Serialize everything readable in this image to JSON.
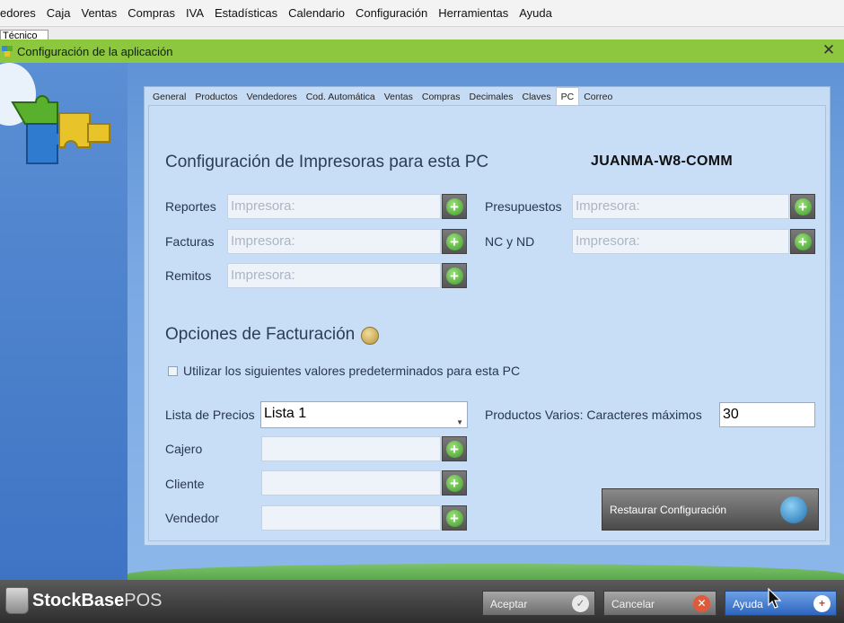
{
  "menubar": {
    "items": [
      "edores",
      "Caja",
      "Ventas",
      "Compras",
      "IVA",
      "Estadísticas",
      "Calendario",
      "Configuración",
      "Herramientas",
      "Ayuda"
    ]
  },
  "subtab": {
    "label": "Técnico"
  },
  "dialog": {
    "title": "Configuración de la aplicación",
    "close": "✕"
  },
  "tabs": [
    "General",
    "Productos",
    "Vendedores",
    "Cod. Automática",
    "Ventas",
    "Compras",
    "Decimales",
    "Claves",
    "PC",
    "Correo"
  ],
  "printers": {
    "title": "Configuración de Impresoras para esta PC",
    "pc_name": "JUANMA-W8-COMM",
    "placeholder": "Impresora:",
    "reportes_label": "Reportes",
    "facturas_label": "Facturas",
    "remitos_label": "Remitos",
    "presupuestos_label": "Presupuestos",
    "ncnd_label": "NC y ND"
  },
  "billing": {
    "title": "Opciones de Facturación",
    "checkbox_label": "Utilizar los siguientes valores predeterminados para esta PC",
    "lista_label": "Lista de Precios",
    "lista_value": "Lista 1",
    "cajero_label": "Cajero",
    "cliente_label": "Cliente",
    "vendedor_label": "Vendedor",
    "varios_label": "Productos Varios: Caracteres máximos",
    "varios_value": "30"
  },
  "restore_label": "Restaurar Configuración",
  "add_glyph": "+",
  "footer": {
    "logo_main": "StockBase",
    "logo_suffix": "POS",
    "accept_label": "Aceptar",
    "cancel_label": "Cancelar",
    "help_label": "Ayuda",
    "accept_glyph": "✓",
    "cancel_glyph": "✕",
    "help_glyph": "+"
  }
}
